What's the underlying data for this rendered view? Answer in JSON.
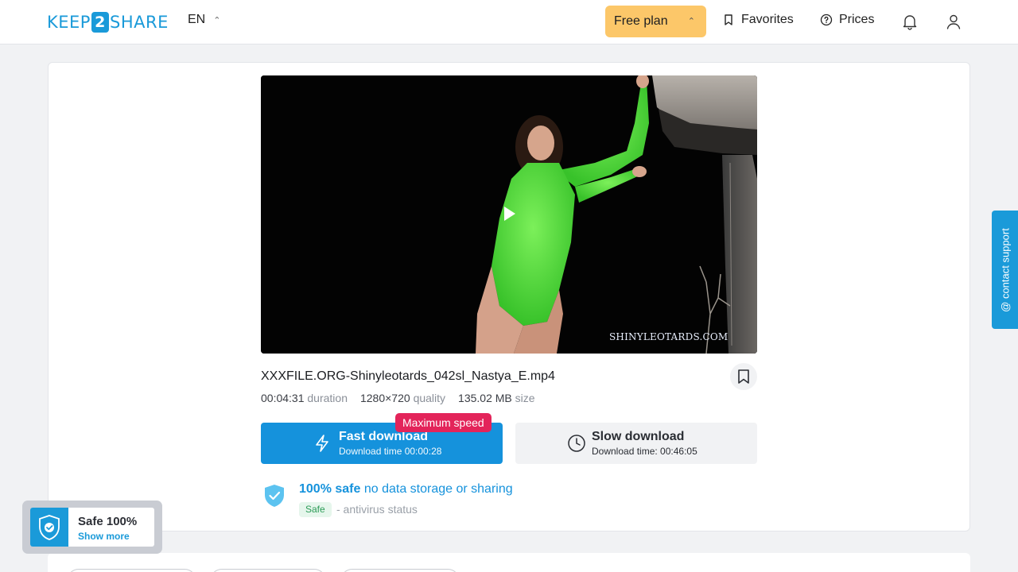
{
  "header": {
    "logo_left": "KEEP",
    "logo_mid": "2",
    "logo_right": "SHARE",
    "language": "EN",
    "plan_label": "Free plan",
    "favorites_label": "Favorites",
    "prices_label": "Prices"
  },
  "file": {
    "name": "XXXFILE.ORG-Shinyleotards_042sl_Nastya_E.mp4",
    "duration": "00:04:31",
    "duration_label": "duration",
    "quality": "1280×720",
    "quality_label": "quality",
    "size": "135.02 MB",
    "size_label": "size",
    "watermark": "SHINYLEOTARDS.COM"
  },
  "download": {
    "fast_title": "Fast download",
    "fast_sub": "Download time 00:00:28",
    "fast_badge": "Maximum speed",
    "slow_title": "Slow download",
    "slow_sub": "Download time: 00:46:05"
  },
  "safety": {
    "headline_bold": "100% safe",
    "headline_rest": "no data storage or sharing",
    "badge": "Safe",
    "status": "- antivirus status"
  },
  "support": {
    "label": "@ contact support"
  },
  "widget": {
    "title": "Safe 100%",
    "link": "Show more"
  },
  "colors": {
    "accent": "#1592dc",
    "plan": "#fcc769",
    "badge": "#e3245a"
  }
}
